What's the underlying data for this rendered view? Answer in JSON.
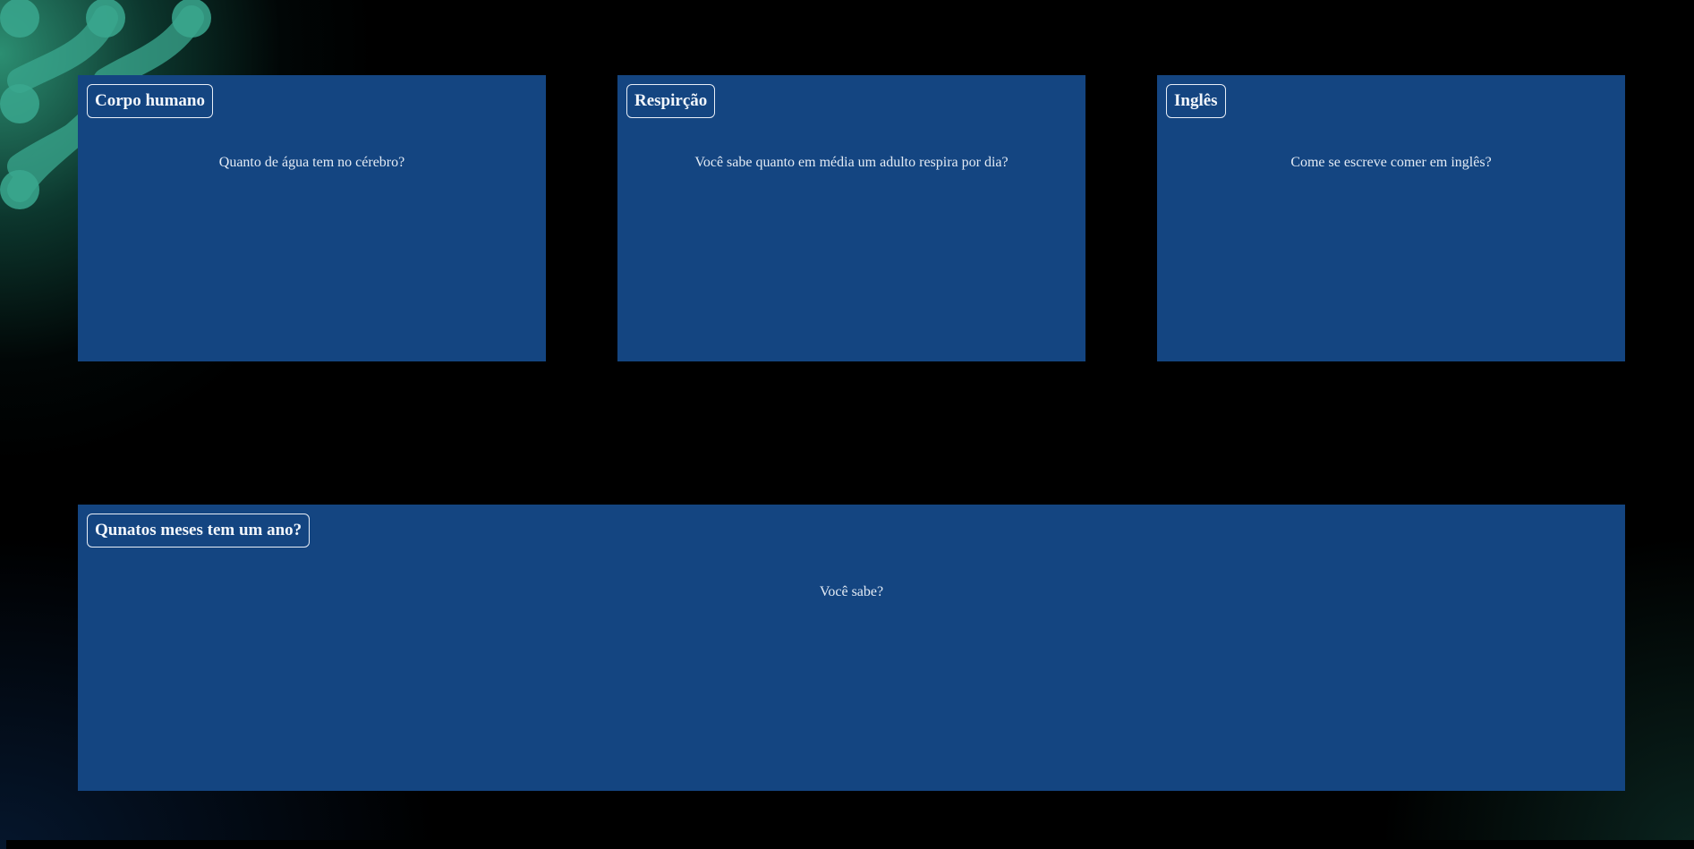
{
  "cards": [
    {
      "title": "Corpo humano",
      "text": "Quanto de água tem no cérebro?"
    },
    {
      "title": "Respirção",
      "text": "Você sabe quanto em média um adulto respira por dia?"
    },
    {
      "title": "Inglês",
      "text": "Come se escreve comer em inglês?"
    },
    {
      "title": "Qunatos meses tem um ano?",
      "text": "Você sabe?"
    }
  ],
  "colors": {
    "card_background": "#144581",
    "page_background": "#000000",
    "decoration_accent": "#4fc0a8"
  }
}
